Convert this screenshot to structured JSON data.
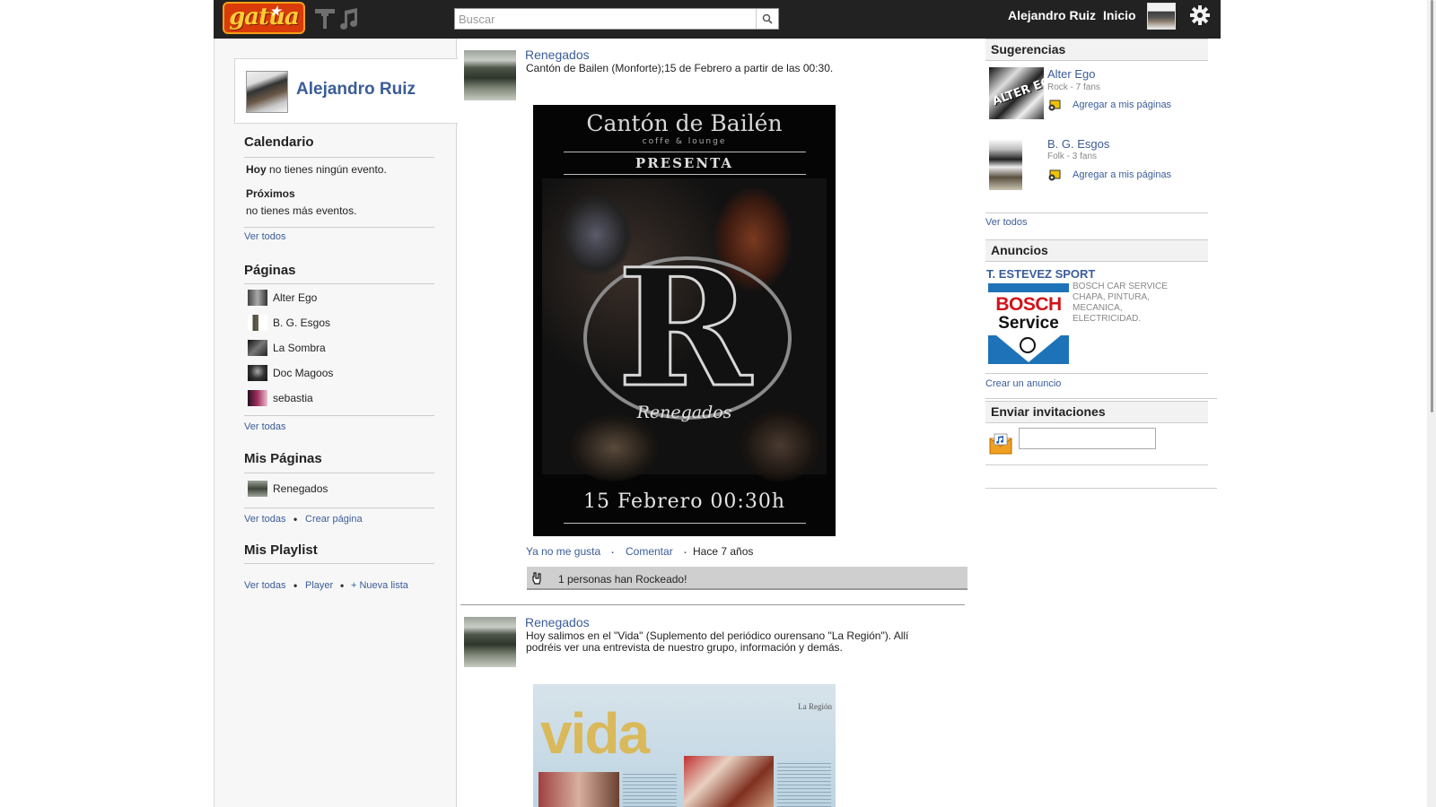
{
  "header": {
    "logo_text": "gatua",
    "search_placeholder": "Buscar",
    "search_value": "",
    "user_name": "Alejandro Ruiz",
    "home_link": "Inicio",
    "icons": [
      "guitar-icon",
      "music-note-icon",
      "search-icon",
      "gear-icon"
    ]
  },
  "profile": {
    "name": "Alejandro Ruiz"
  },
  "calendar": {
    "title": "Calendario",
    "today_bold": "Hoy",
    "today_text": "no tienes ningún evento.",
    "upcoming_title": "Próximos",
    "upcoming_text": "no tienes más eventos.",
    "see_all": "Ver todos"
  },
  "pages": {
    "title": "Páginas",
    "items": [
      {
        "label": "Alter Ego"
      },
      {
        "label": "B. G. Esgos"
      },
      {
        "label": "La Sombra"
      },
      {
        "label": "Doc Magoos"
      },
      {
        "label": "sebastia"
      }
    ],
    "see_all": "Ver todas"
  },
  "my_pages": {
    "title": "Mis Páginas",
    "items": [
      {
        "label": "Renegados"
      }
    ],
    "see_all": "Ver todas",
    "create": "Crear página"
  },
  "playlist": {
    "title": "Mis Playlist",
    "see_all": "Ver todas",
    "player": "Player",
    "new_list": "+ Nueva lista"
  },
  "feed": {
    "posts": [
      {
        "author": "Renegados",
        "text": "Cantón de Bailen (Monforte);15 de Febrero a partir de las 00:30.",
        "poster": {
          "venue": "Cantón de Bailén",
          "venue_sub": "coffe & lounge",
          "presenta": "PRESENTA",
          "letter": "R",
          "band": "Renegados",
          "date": "15 Febrero 00:30h"
        },
        "unlike": "Ya no me gusta",
        "comment": "Comentar",
        "time": "Hace 7 años",
        "rock_text": "1 personas han Rockeado!"
      },
      {
        "author": "Renegados",
        "text": "Hoy salimos en el \"Vida\" (Suplemento del periódico ourensano \"La Región\"). Allí podréis ver una entrevista de nuestro grupo, información y demás.",
        "image_word": "vida",
        "image_corner": "La Región"
      }
    ]
  },
  "suggestions": {
    "title": "Sugerencias",
    "items": [
      {
        "name": "Alter Ego",
        "meta": "Rock - 7 fans",
        "add": "Agregar a mis páginas",
        "thumb_text": "ALTER EGO"
      },
      {
        "name": "B. G. Esgos",
        "meta": "Folk - 3 fans",
        "add": "Agregar a mis páginas"
      }
    ],
    "see_all": "Ver todos"
  },
  "ads": {
    "title": "Anuncios",
    "ad_title": "T. ESTEVEZ SPORT",
    "ad_text": "BOSCH CAR SERVICE CHAPA, PINTURA, MECANICA, ELECTRICIDAD.",
    "brand_word": "BOSCH",
    "brand_service": "Service",
    "create": "Crear un anuncio"
  },
  "invites": {
    "title": "Enviar invitaciones",
    "input_value": ""
  },
  "colors": {
    "topbar": "#222222",
    "link": "#3b5c98",
    "logo": "#d93b0b"
  }
}
